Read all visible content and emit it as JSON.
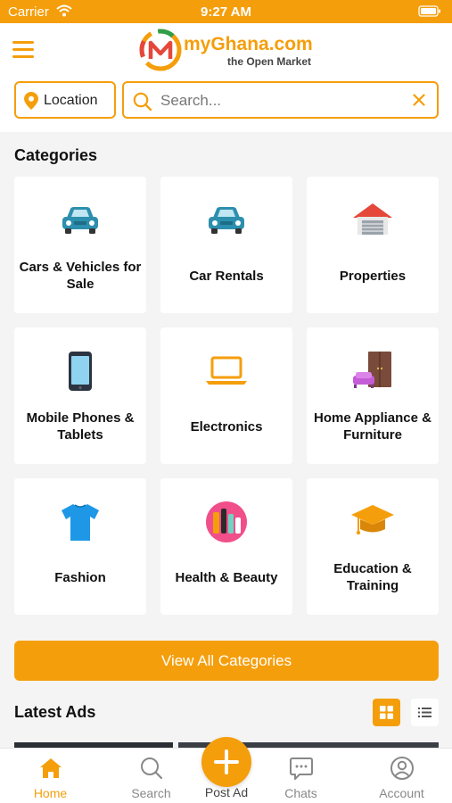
{
  "status_bar": {
    "carrier": "Carrier",
    "time": "9:27 AM"
  },
  "header": {
    "brand_name": "myGhana.com",
    "tagline": "the Open Market"
  },
  "search": {
    "location_label": "Location",
    "placeholder": "Search..."
  },
  "categories": {
    "title": "Categories",
    "items": [
      {
        "label": "Cars & Vehicles for Sale",
        "icon": "car-icon"
      },
      {
        "label": "Car Rentals",
        "icon": "car-icon"
      },
      {
        "label": "Properties",
        "icon": "house-icon"
      },
      {
        "label": "Mobile Phones & Tablets",
        "icon": "phone-icon"
      },
      {
        "label": "Electronics",
        "icon": "laptop-icon"
      },
      {
        "label": "Home Appliance & Furniture",
        "icon": "furniture-icon"
      },
      {
        "label": "Fashion",
        "icon": "tshirt-icon"
      },
      {
        "label": "Health & Beauty",
        "icon": "cosmetics-icon"
      },
      {
        "label": "Education & Training",
        "icon": "graduation-cap-icon"
      }
    ],
    "view_all_label": "View All Categories"
  },
  "latest_ads": {
    "title": "Latest Ads",
    "active_view": "grid"
  },
  "bottom_nav": {
    "items": [
      {
        "label": "Home",
        "icon": "home-icon",
        "active": true
      },
      {
        "label": "Search",
        "icon": "search-icon",
        "active": false
      },
      {
        "label": "Post Ad",
        "icon": "plus-icon",
        "active": false
      },
      {
        "label": "Chats",
        "icon": "chat-icon",
        "active": false
      },
      {
        "label": "Account",
        "icon": "account-icon",
        "active": false
      }
    ]
  },
  "colors": {
    "accent": "#f59e0b",
    "background": "#f4f4f4",
    "card": "#ffffff"
  }
}
